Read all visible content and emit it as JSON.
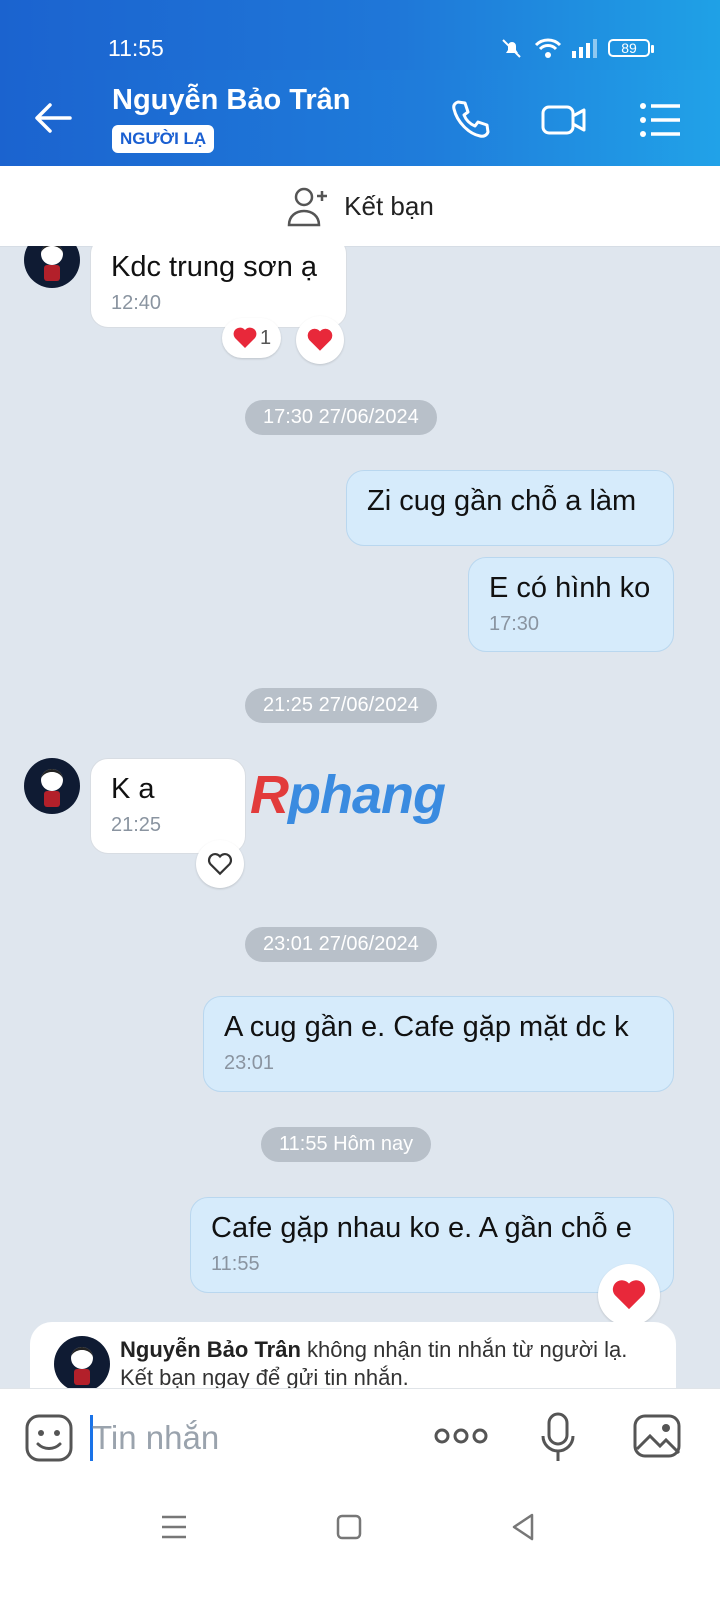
{
  "status": {
    "time": "11:55",
    "battery": "89"
  },
  "header": {
    "name": "Nguyễn Bảo Trân",
    "badge": "NGƯỜI LẠ"
  },
  "friend_bar": {
    "label": "Kết bạn"
  },
  "messages": {
    "m1": {
      "text": "Kdc trung sơn ạ",
      "time": "12:40",
      "reaction_count": "1"
    },
    "d1": "17:30 27/06/2024",
    "m2": {
      "text": "Zi cug gần chỗ a làm"
    },
    "m3": {
      "text": "E có hình ko",
      "time": "17:30"
    },
    "d2": "21:25 27/06/2024",
    "m4": {
      "text": "K a",
      "time": "21:25"
    },
    "d3": "23:01 27/06/2024",
    "m5": {
      "text": "A cug gần e. Cafe gặp mặt dc k",
      "time": "23:01"
    },
    "d4": "11:55 Hôm nay",
    "m6": {
      "text": "Cafe gặp nhau ko e. A gần chỗ e",
      "time": "11:55"
    }
  },
  "watermark": {
    "r": "R",
    "rest": "phang"
  },
  "notice": {
    "name": "Nguyễn Bảo Trân",
    "line1": " không nhận tin nhắn từ người lạ.",
    "line2": "Kết bạn ngay để gửi tin nhắn."
  },
  "input": {
    "placeholder": "Tin nhắn"
  },
  "colors": {
    "header": "#1f77d8",
    "out_bubble": "#d6ebfb",
    "heart": "#e8283a"
  }
}
